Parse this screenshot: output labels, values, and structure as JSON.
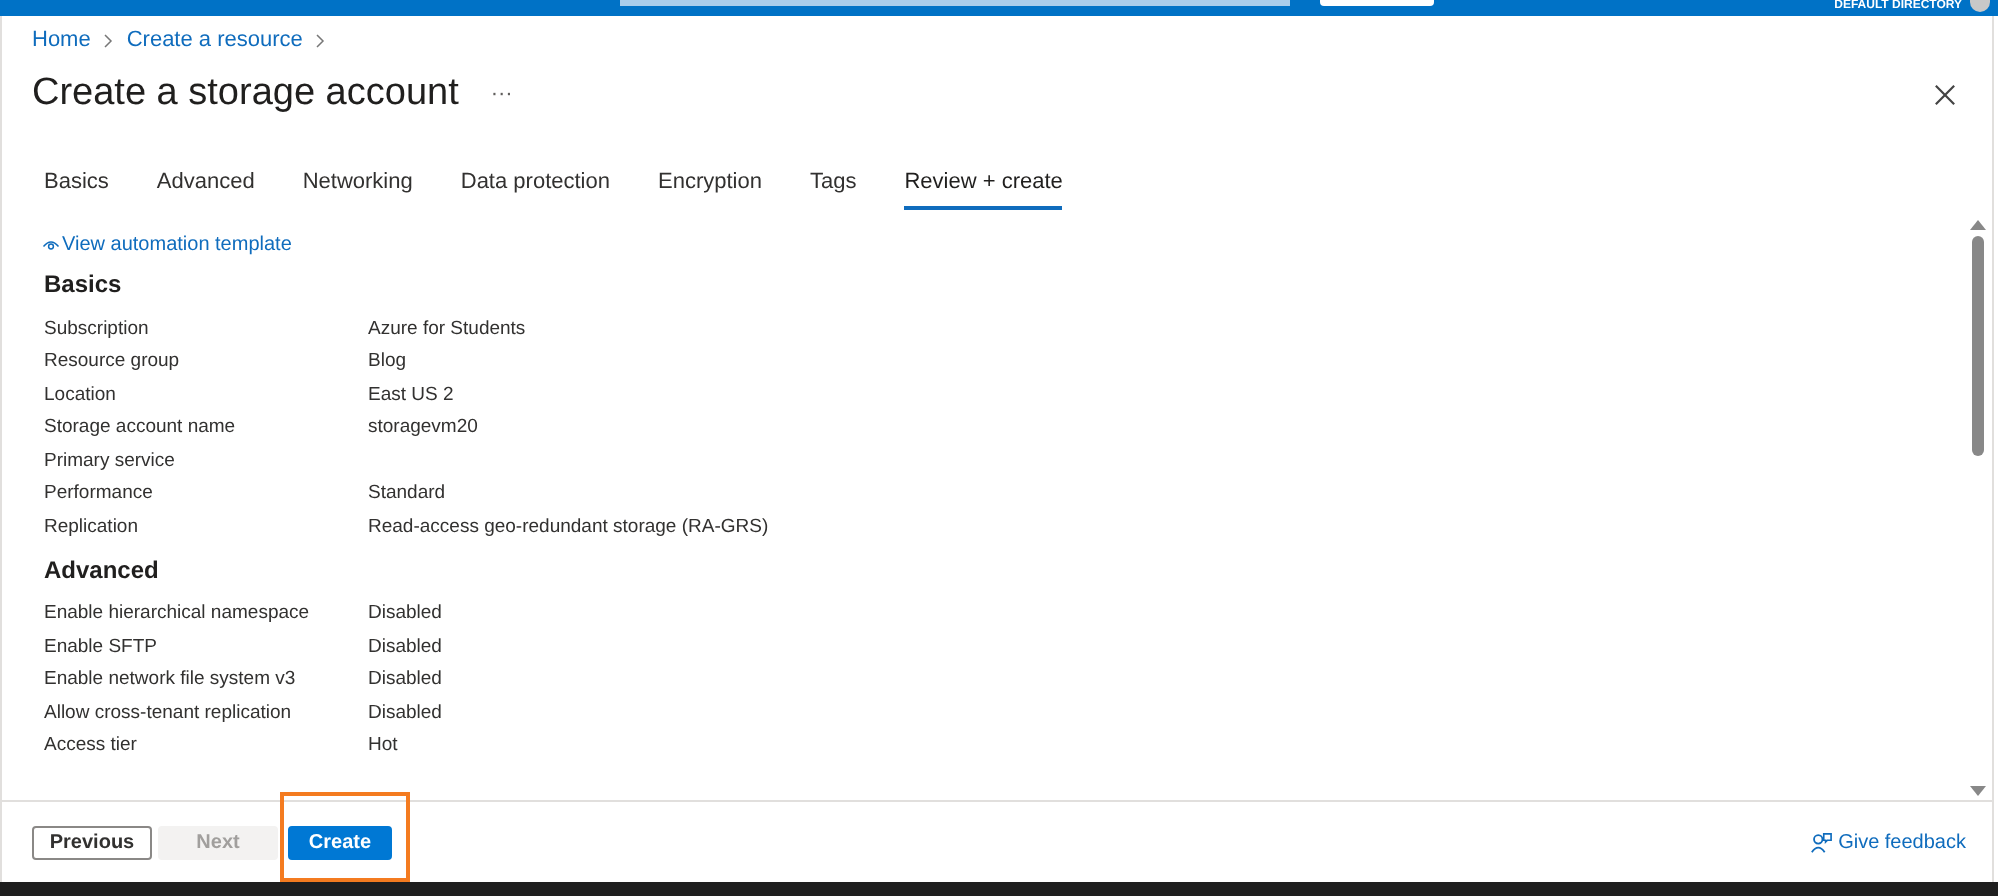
{
  "top_bar": {
    "directory": "DEFAULT DIRECTORY"
  },
  "breadcrumb": [
    "Home",
    "Create a resource"
  ],
  "title": "Create a storage account",
  "more": "···",
  "tabs": [
    {
      "label": "Basics",
      "selected": false
    },
    {
      "label": "Advanced",
      "selected": false
    },
    {
      "label": "Networking",
      "selected": false
    },
    {
      "label": "Data protection",
      "selected": false
    },
    {
      "label": "Encryption",
      "selected": false
    },
    {
      "label": "Tags",
      "selected": false
    },
    {
      "label": "Review + create",
      "selected": true
    }
  ],
  "automation_link": "View automation template",
  "sections": [
    {
      "heading": "Basics",
      "rows": [
        {
          "label": "Subscription",
          "value": "Azure for Students"
        },
        {
          "label": "Resource group",
          "value": "Blog"
        },
        {
          "label": "Location",
          "value": "East US 2"
        },
        {
          "label": "Storage account name",
          "value": "storagevm20"
        },
        {
          "label": "Primary service",
          "value": ""
        },
        {
          "label": "Performance",
          "value": "Standard"
        },
        {
          "label": "Replication",
          "value": "Read-access geo-redundant storage (RA-GRS)"
        }
      ]
    },
    {
      "heading": "Advanced",
      "rows": [
        {
          "label": "Enable hierarchical namespace",
          "value": "Disabled"
        },
        {
          "label": "Enable SFTP",
          "value": "Disabled"
        },
        {
          "label": "Enable network file system v3",
          "value": "Disabled"
        },
        {
          "label": "Allow cross-tenant replication",
          "value": "Disabled"
        },
        {
          "label": "Access tier",
          "value": "Hot"
        }
      ]
    }
  ],
  "footer": {
    "buttons": [
      {
        "label": "Previous",
        "kind": "secondary",
        "disabled": false
      },
      {
        "label": "Next",
        "kind": "secondary",
        "disabled": true
      },
      {
        "label": "Create",
        "kind": "primary",
        "disabled": false,
        "highlighted": true
      }
    ],
    "feedback": "Give feedback"
  }
}
